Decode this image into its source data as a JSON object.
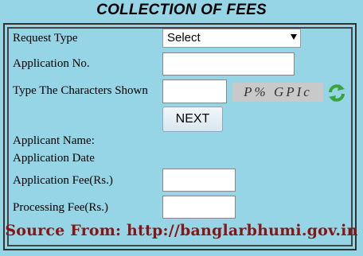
{
  "page_title": "COLLECTION OF FEES",
  "form": {
    "request_type_label": "Request Type",
    "request_type_value": "Select",
    "application_no_label": "Application No.",
    "captcha_label": "Type The Characters Shown",
    "captcha_text": "P% GPIc",
    "next_label": "NEXT",
    "applicant_name_label": "Applicant Name:",
    "application_date_label": "Application Date",
    "application_fee_label": "Application Fee(Rs.)",
    "processing_fee_label": "Processing Fee(Rs.)"
  },
  "source_text": "Source From: http://banglarbhumi.gov.in",
  "icons": {
    "refresh": "refresh-icon"
  },
  "colors": {
    "background": "#95d5e6",
    "source_text": "#8b1313",
    "refresh_icon": "#3aa33a"
  }
}
